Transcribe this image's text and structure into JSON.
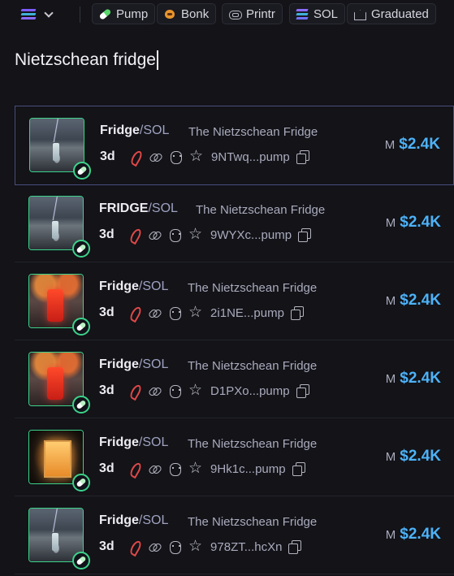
{
  "header": {
    "chain_icon": "solana-logo",
    "filters": [
      {
        "label": "Pump",
        "icon": "pill-icon"
      },
      {
        "label": "Bonk",
        "icon": "bonk-icon"
      },
      {
        "label": "Printr",
        "icon": "printr-icon"
      },
      {
        "label": "SOL",
        "icon": "solana-icon"
      },
      {
        "label": "Graduated",
        "icon": "crown-icon"
      }
    ]
  },
  "search": {
    "value": "Nietzschean fridge"
  },
  "results": [
    {
      "ticker": "Fridge",
      "pair": "/SOL",
      "name": "The Nietzschean Fridge",
      "age": "3d",
      "address": "9NTwq...pump",
      "mcap_label": "M",
      "mcap": "$2.4K",
      "image": "storm-bottle"
    },
    {
      "ticker": "FRIDGE",
      "pair": "/SOL",
      "name": "The Nietzschean Fridge",
      "age": "3d",
      "address": "9WYXc...pump",
      "mcap_label": "M",
      "mcap": "$2.4K",
      "image": "storm-bottle"
    },
    {
      "ticker": "Fridge",
      "pair": "/SOL",
      "name": "The Nietzschean Fridge",
      "age": "3d",
      "address": "2i1NE...pump",
      "mcap_label": "M",
      "mcap": "$2.4K",
      "image": "red-fridge"
    },
    {
      "ticker": "Fridge",
      "pair": "/SOL",
      "name": "The Nietzschean Fridge",
      "age": "3d",
      "address": "D1PXo...pump",
      "mcap_label": "M",
      "mcap": "$2.4K",
      "image": "red-fridge"
    },
    {
      "ticker": "Fridge",
      "pair": "/SOL",
      "name": "The Nietzschean Fridge",
      "age": "3d",
      "address": "9Hk1c...pump",
      "mcap_label": "M",
      "mcap": "$2.4K",
      "image": "open-fridge"
    },
    {
      "ticker": "Fridge",
      "pair": "/SOL",
      "name": "The Nietzschean Fridge",
      "age": "3d",
      "address": "978ZT...hcXn",
      "mcap_label": "M",
      "mcap": "$2.4K",
      "image": "storm-bottle"
    }
  ],
  "colors": {
    "accent": "#4db2f7",
    "border_green": "#3cd38a",
    "background": "#131318"
  }
}
